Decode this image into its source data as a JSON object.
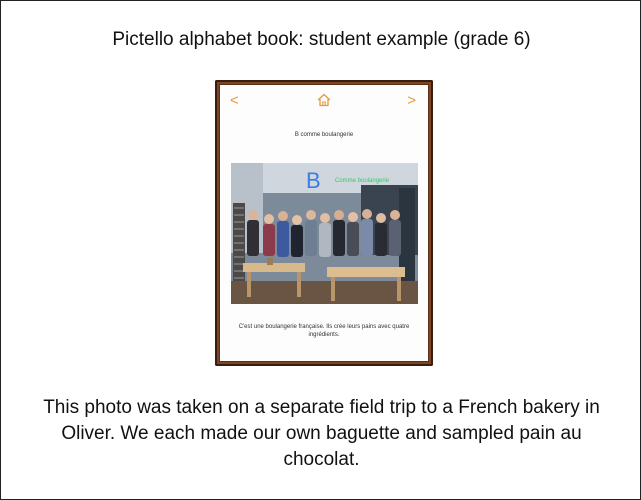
{
  "heading": "Pictello alphabet book:  student example (grade 6)",
  "app_screen": {
    "nav": {
      "back_glyph": "<",
      "home_icon": "home-icon",
      "forward_glyph": ">"
    },
    "page_title": "B comme boulangerie",
    "photo_overlay": {
      "letter": "B",
      "text": "Comme boulangerie"
    },
    "caption": "C'est une boulangerie française. Ils crée leurs pains avec quatre ingrédients."
  },
  "body_text": "This photo was taken on a separate field trip to a French bakery in Oliver. We each made our own baguette and sampled pain au chocolat.",
  "colors": {
    "nav_accent": "#e69a3a",
    "overlay_letter": "#3b7de0",
    "overlay_text": "#3cc46a",
    "device_frame": "#5a2f17"
  }
}
